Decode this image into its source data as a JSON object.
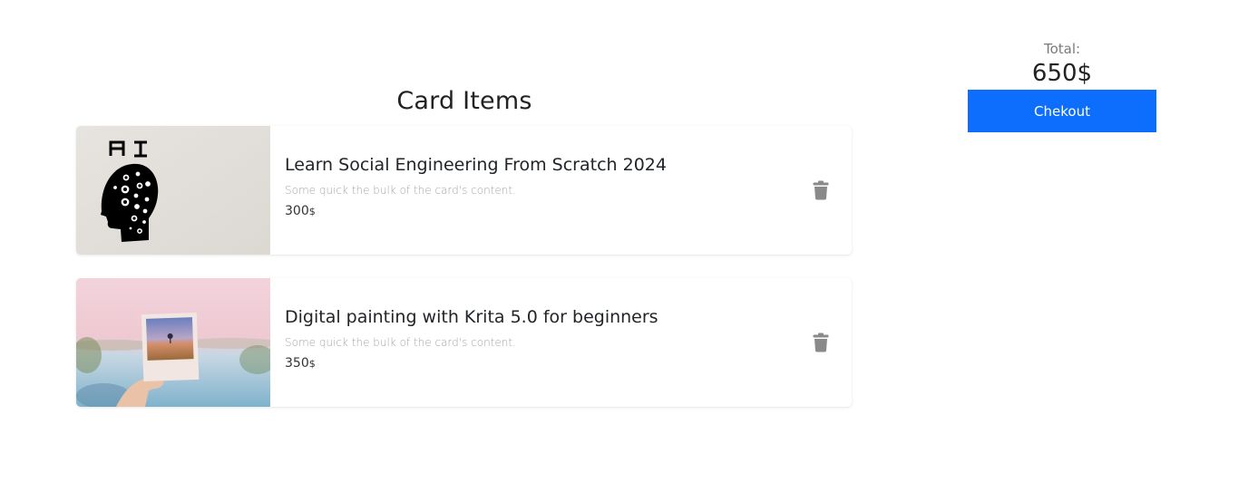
{
  "cart": {
    "title": "Card Items",
    "items": [
      {
        "title": "Learn Social Engineering From Scratch 2024",
        "description": "Some quick the bulk of the card's content.",
        "price": "300",
        "currency": "$",
        "image_icon": "ai-head-illustration",
        "image_text": "AI"
      },
      {
        "title": "Digital painting with Krita 5.0 for beginners",
        "description": "Some quick the bulk of the card's content.",
        "price": "350",
        "currency": "$",
        "image_icon": "polaroid-photo-in-hand"
      }
    ],
    "delete_icon": "trash-icon"
  },
  "summary": {
    "total_label": "Total:",
    "total_value": "650$",
    "checkout_label": "Chekout"
  },
  "colors": {
    "primary": "#0d6efd",
    "trash": "#8a8a8a",
    "muted_text": "#a6a6a6"
  }
}
